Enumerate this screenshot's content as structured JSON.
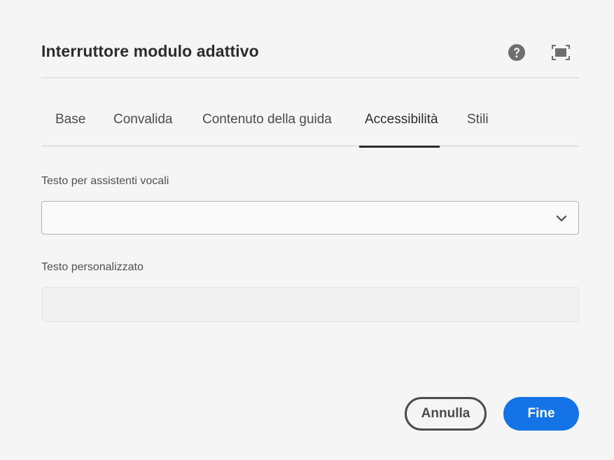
{
  "dialog": {
    "title": "Interruttore modulo adattivo",
    "icons": {
      "help": "help-circle-icon",
      "fullscreen": "fullscreen-icon"
    }
  },
  "tabs": [
    {
      "label": "Base",
      "active": false
    },
    {
      "label": "Convalida",
      "active": false
    },
    {
      "label": "Contenuto della guida",
      "active": false
    },
    {
      "label": "Accessibilità",
      "active": true
    },
    {
      "label": "Stili",
      "active": false
    }
  ],
  "fields": {
    "screen_reader_text": {
      "label": "Testo per assistenti vocali",
      "value": ""
    },
    "custom_text": {
      "label": "Testo personalizzato",
      "value": "",
      "placeholder": ""
    }
  },
  "footer": {
    "cancel_label": "Annulla",
    "done_label": "Fine"
  },
  "colors": {
    "primary": "#1473e6",
    "text": "#2c2c2c",
    "background": "#f5f5f5"
  }
}
